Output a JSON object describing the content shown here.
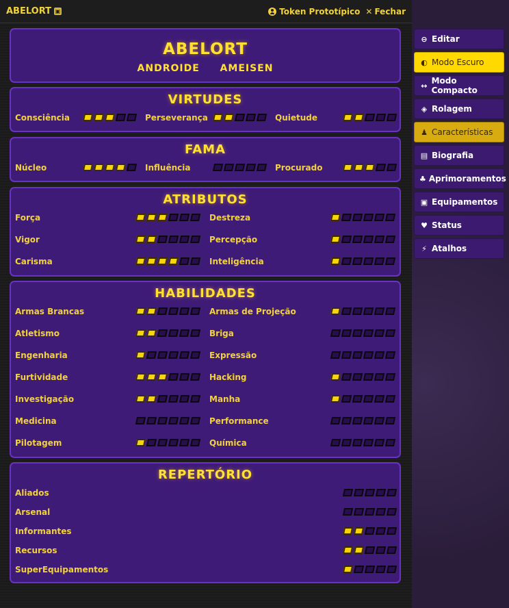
{
  "window": {
    "title": "ABELORT",
    "token_label": "Token Prototípico",
    "close_label": "Fechar"
  },
  "header": {
    "name": "ABELORT",
    "subtitle_left": "ANDROIDE",
    "subtitle_right": "AMEISEN"
  },
  "virtudes": {
    "title": "VIRTUDES",
    "items": [
      {
        "label": "Consciência",
        "value": 3,
        "max": 5
      },
      {
        "label": "Perseverança",
        "value": 2,
        "max": 5
      },
      {
        "label": "Quietude",
        "value": 2,
        "max": 5
      }
    ]
  },
  "fama": {
    "title": "FAMA",
    "items": [
      {
        "label": "Núcleo",
        "value": 4,
        "max": 5
      },
      {
        "label": "Influência",
        "value": 0,
        "max": 5
      },
      {
        "label": "Procurado",
        "value": 3,
        "max": 5
      }
    ]
  },
  "atributos": {
    "title": "ATRIBUTOS",
    "items": [
      {
        "label": "Força",
        "value": 3,
        "max": 6
      },
      {
        "label": "Destreza",
        "value": 1,
        "max": 6
      },
      {
        "label": "Vigor",
        "value": 2,
        "max": 6
      },
      {
        "label": "Percepção",
        "value": 1,
        "max": 6
      },
      {
        "label": "Carisma",
        "value": 4,
        "max": 6
      },
      {
        "label": "Inteligência",
        "value": 1,
        "max": 6
      }
    ]
  },
  "habilidades": {
    "title": "HABILIDADES",
    "items": [
      {
        "label": "Armas Brancas",
        "value": 2,
        "max": 6
      },
      {
        "label": "Armas de Projeção",
        "value": 1,
        "max": 6
      },
      {
        "label": "Atletismo",
        "value": 2,
        "max": 6
      },
      {
        "label": "Briga",
        "value": 0,
        "max": 6
      },
      {
        "label": "Engenharia",
        "value": 1,
        "max": 6
      },
      {
        "label": "Expressão",
        "value": 0,
        "max": 6
      },
      {
        "label": "Furtividade",
        "value": 3,
        "max": 6
      },
      {
        "label": "Hacking",
        "value": 1,
        "max": 6
      },
      {
        "label": "Investigação",
        "value": 2,
        "max": 6
      },
      {
        "label": "Manha",
        "value": 1,
        "max": 6
      },
      {
        "label": "Medicina",
        "value": 0,
        "max": 6
      },
      {
        "label": "Performance",
        "value": 0,
        "max": 6
      },
      {
        "label": "Pilotagem",
        "value": 1,
        "max": 6
      },
      {
        "label": "Química",
        "value": 0,
        "max": 6
      }
    ]
  },
  "repertorio": {
    "title": "REPERTÓRIO",
    "items": [
      {
        "label": "Aliados",
        "value": 0,
        "max": 5
      },
      {
        "label": "Arsenal",
        "value": 0,
        "max": 5
      },
      {
        "label": "Informantes",
        "value": 2,
        "max": 5
      },
      {
        "label": "Recursos",
        "value": 2,
        "max": 5
      },
      {
        "label": "SuperEquipamentos",
        "value": 1,
        "max": 5
      }
    ]
  },
  "sidebar": {
    "items": [
      {
        "label": "Editar",
        "icon": "toggle-icon",
        "glyph": "⊖"
      },
      {
        "label": "Modo Escuro",
        "icon": "contrast-icon",
        "glyph": "◐"
      },
      {
        "label": "Modo Compacto",
        "icon": "compress-icon",
        "glyph": "↔"
      },
      {
        "label": "Rolagem",
        "icon": "dice-icon",
        "glyph": "◈"
      },
      {
        "label": "Características",
        "icon": "user-stats-icon",
        "glyph": "♟"
      },
      {
        "label": "Biografia",
        "icon": "book-icon",
        "glyph": "▤"
      },
      {
        "label": "Aprimoramentos",
        "icon": "lungs-icon",
        "glyph": "♣"
      },
      {
        "label": "Equipamentos",
        "icon": "suitcase-icon",
        "glyph": "▣"
      },
      {
        "label": "Status",
        "icon": "heartbeat-icon",
        "glyph": "♥"
      },
      {
        "label": "Atalhos",
        "icon": "lightning-icon",
        "glyph": "⚡"
      }
    ]
  },
  "colors": {
    "panel_bg": "#3f1b78",
    "panel_border": "#6a32c2",
    "accent_yellow": "#f2d23c",
    "dot_filled": "#f7d40c"
  }
}
